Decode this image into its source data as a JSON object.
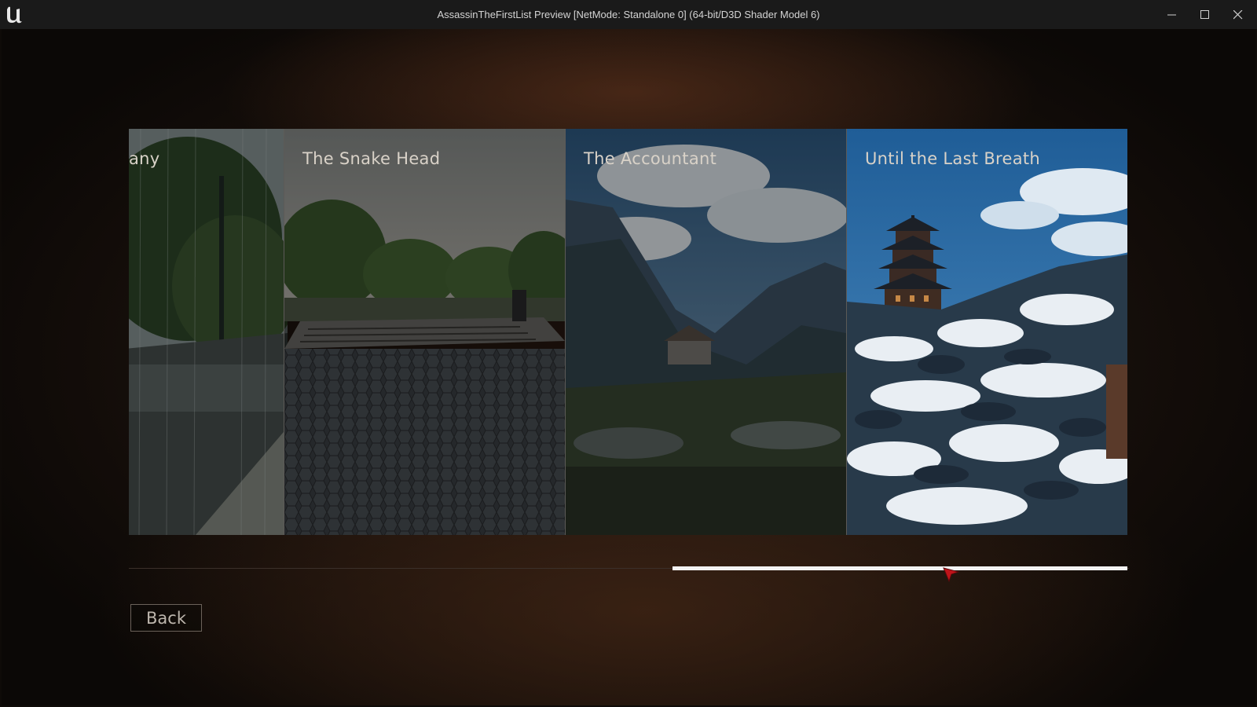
{
  "window": {
    "title": "AssassinTheFirstList Preview [NetMode: Standalone 0]  (64-bit/D3D Shader Model 6)",
    "logo_icon": "unreal-engine-logo-icon",
    "controls": [
      "minimize-icon",
      "maximize-icon",
      "close-icon"
    ]
  },
  "levels": {
    "cards": [
      {
        "title": "any",
        "theme": "rainy-street"
      },
      {
        "title": "The Snake Head",
        "theme": "park-plaza"
      },
      {
        "title": "The Accountant",
        "theme": "mountain-valley"
      },
      {
        "title": "Until the Last Breath",
        "theme": "snowy-pagoda"
      }
    ]
  },
  "scrollbar": {
    "position_fraction": 0.53,
    "thumb_fraction": 0.45
  },
  "menu": {
    "back_label": "Back"
  },
  "colors": {
    "accent_cursor": "#c0141a",
    "thumb": "#f3f3f3"
  }
}
